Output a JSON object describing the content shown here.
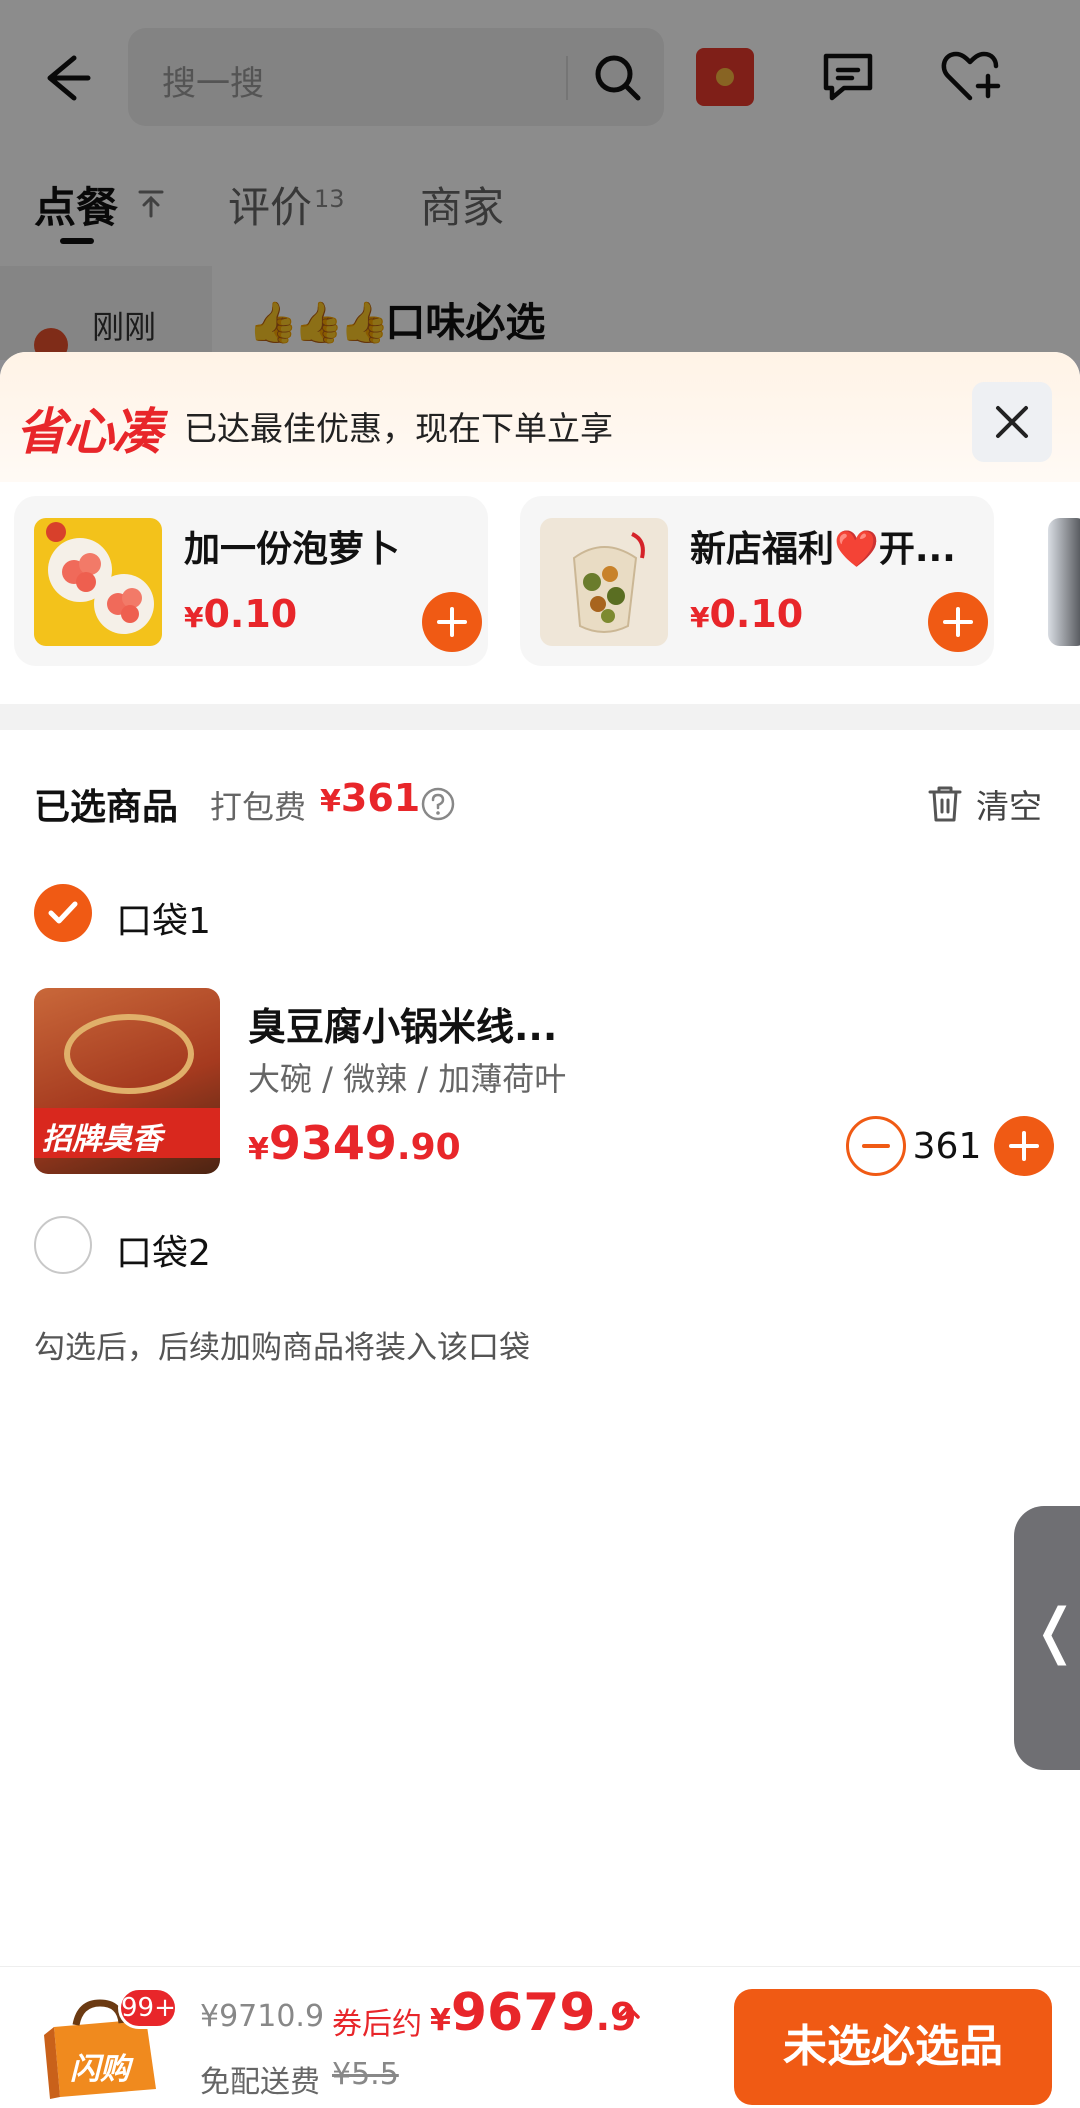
{
  "header": {
    "search_placeholder": "搜一搜",
    "icons": [
      "back-arrow-icon",
      "search-icon",
      "red-packet-icon",
      "message-icon",
      "favorite-heart-icon"
    ]
  },
  "tabs": {
    "order": "点餐",
    "reviews": "评价",
    "reviews_count": "13",
    "merchant": "商家"
  },
  "sidebar": {
    "category_label": "刚刚"
  },
  "menu": {
    "section_emoji": "👍👍👍",
    "section_title": "口味必选"
  },
  "promo": {
    "logo": "省心凑",
    "text": "已达最佳优惠，现在下单立享",
    "addons": [
      {
        "name": "加一份泡萝卜",
        "currency": "¥",
        "price": "0.10"
      },
      {
        "name": "新店福利❤️开...",
        "currency": "¥",
        "price": "0.10"
      }
    ]
  },
  "cart": {
    "title": "已选商品",
    "packing_fee_label": "打包费",
    "packing_fee_currency": "¥",
    "packing_fee": "361",
    "clear_label": "清空",
    "bag1_label": "口袋1",
    "bag2_label": "口袋2",
    "hint": "勾选后，后续加购商品将装入该口袋",
    "item": {
      "name": "臭豆腐小锅米线...",
      "spec": "大碗 / 微辣 / 加薄荷叶",
      "image_banner": "招牌臭香",
      "currency": "¥",
      "price_int": "9349",
      "price_dec": ".90",
      "quantity": "361"
    }
  },
  "side_tab": {
    "glyph": "❬"
  },
  "bottom": {
    "badge": "99+",
    "bag_icon_label": "闪购",
    "original_total": "¥9710.9",
    "after_coupon_label": "券后约",
    "final_currency": "¥",
    "final_int": "9679",
    "final_dec": ".9",
    "delivery_label": "免配送费",
    "delivery_original": "¥5.5",
    "checkout_label": "未选必选品"
  },
  "colors": {
    "accent": "#f05a14",
    "price": "#e8262a"
  }
}
